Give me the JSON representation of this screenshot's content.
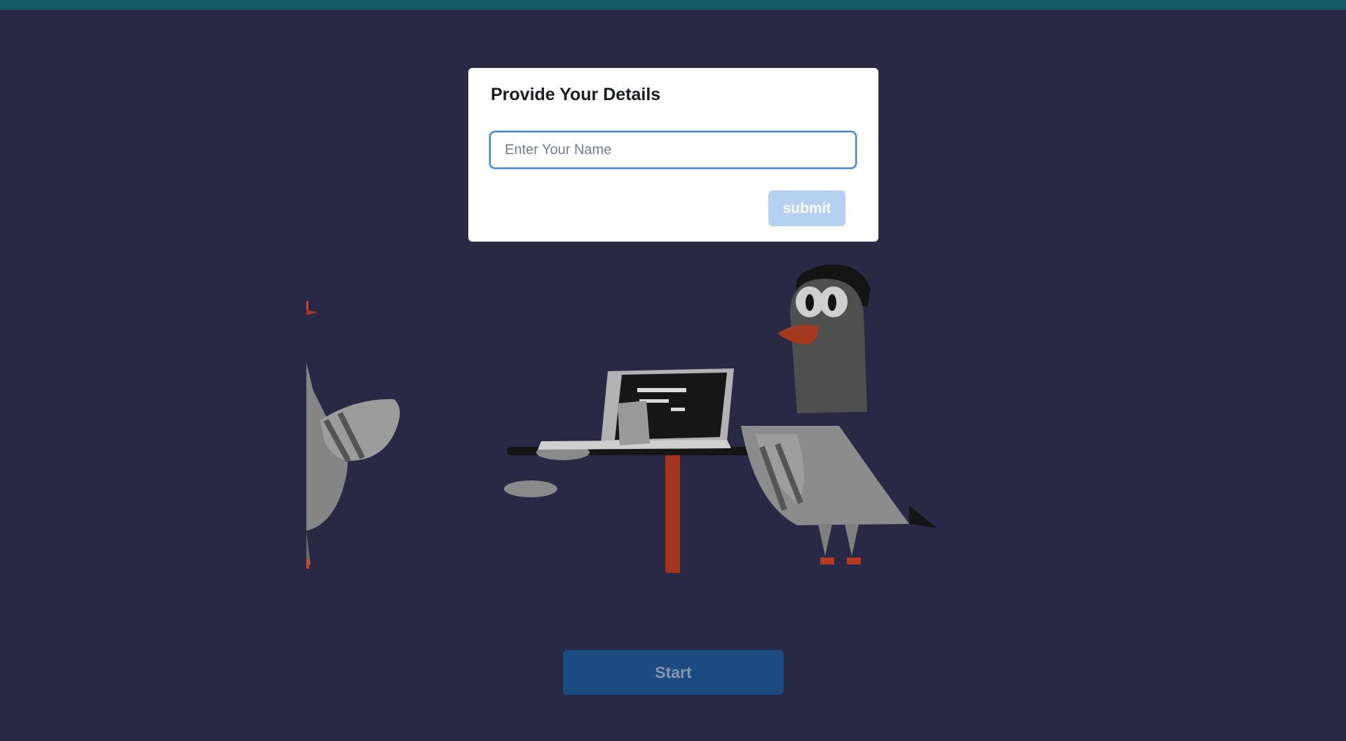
{
  "modal": {
    "title": "Provide Your Details",
    "name_placeholder": "Enter Your Name",
    "name_value": "",
    "submit_label": "submit"
  },
  "page": {
    "start_label": "Start"
  },
  "colors": {
    "background": "#292845",
    "top_bar": "#135b66",
    "modal_bg": "#ffffff",
    "input_border": "#3d83d0",
    "submit_bg": "#b4d1f1",
    "start_bg": "#1b4b80"
  },
  "illustration": {
    "subject": "pigeon-at-laptop-illustration"
  }
}
